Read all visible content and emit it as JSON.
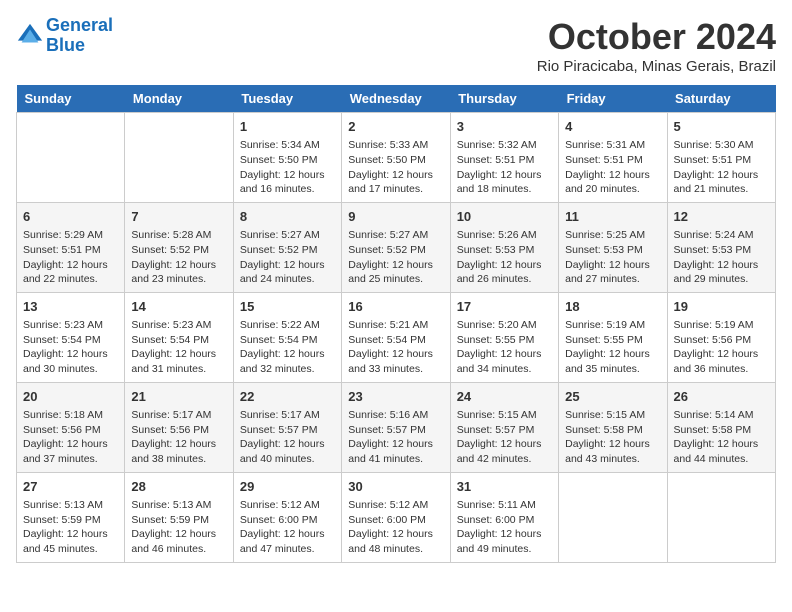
{
  "header": {
    "logo_line1": "General",
    "logo_line2": "Blue",
    "month": "October 2024",
    "location": "Rio Piracicaba, Minas Gerais, Brazil"
  },
  "days_of_week": [
    "Sunday",
    "Monday",
    "Tuesday",
    "Wednesday",
    "Thursday",
    "Friday",
    "Saturday"
  ],
  "weeks": [
    [
      {
        "num": "",
        "info": ""
      },
      {
        "num": "",
        "info": ""
      },
      {
        "num": "1",
        "info": "Sunrise: 5:34 AM\nSunset: 5:50 PM\nDaylight: 12 hours and 16 minutes."
      },
      {
        "num": "2",
        "info": "Sunrise: 5:33 AM\nSunset: 5:50 PM\nDaylight: 12 hours and 17 minutes."
      },
      {
        "num": "3",
        "info": "Sunrise: 5:32 AM\nSunset: 5:51 PM\nDaylight: 12 hours and 18 minutes."
      },
      {
        "num": "4",
        "info": "Sunrise: 5:31 AM\nSunset: 5:51 PM\nDaylight: 12 hours and 20 minutes."
      },
      {
        "num": "5",
        "info": "Sunrise: 5:30 AM\nSunset: 5:51 PM\nDaylight: 12 hours and 21 minutes."
      }
    ],
    [
      {
        "num": "6",
        "info": "Sunrise: 5:29 AM\nSunset: 5:51 PM\nDaylight: 12 hours and 22 minutes."
      },
      {
        "num": "7",
        "info": "Sunrise: 5:28 AM\nSunset: 5:52 PM\nDaylight: 12 hours and 23 minutes."
      },
      {
        "num": "8",
        "info": "Sunrise: 5:27 AM\nSunset: 5:52 PM\nDaylight: 12 hours and 24 minutes."
      },
      {
        "num": "9",
        "info": "Sunrise: 5:27 AM\nSunset: 5:52 PM\nDaylight: 12 hours and 25 minutes."
      },
      {
        "num": "10",
        "info": "Sunrise: 5:26 AM\nSunset: 5:53 PM\nDaylight: 12 hours and 26 minutes."
      },
      {
        "num": "11",
        "info": "Sunrise: 5:25 AM\nSunset: 5:53 PM\nDaylight: 12 hours and 27 minutes."
      },
      {
        "num": "12",
        "info": "Sunrise: 5:24 AM\nSunset: 5:53 PM\nDaylight: 12 hours and 29 minutes."
      }
    ],
    [
      {
        "num": "13",
        "info": "Sunrise: 5:23 AM\nSunset: 5:54 PM\nDaylight: 12 hours and 30 minutes."
      },
      {
        "num": "14",
        "info": "Sunrise: 5:23 AM\nSunset: 5:54 PM\nDaylight: 12 hours and 31 minutes."
      },
      {
        "num": "15",
        "info": "Sunrise: 5:22 AM\nSunset: 5:54 PM\nDaylight: 12 hours and 32 minutes."
      },
      {
        "num": "16",
        "info": "Sunrise: 5:21 AM\nSunset: 5:54 PM\nDaylight: 12 hours and 33 minutes."
      },
      {
        "num": "17",
        "info": "Sunrise: 5:20 AM\nSunset: 5:55 PM\nDaylight: 12 hours and 34 minutes."
      },
      {
        "num": "18",
        "info": "Sunrise: 5:19 AM\nSunset: 5:55 PM\nDaylight: 12 hours and 35 minutes."
      },
      {
        "num": "19",
        "info": "Sunrise: 5:19 AM\nSunset: 5:56 PM\nDaylight: 12 hours and 36 minutes."
      }
    ],
    [
      {
        "num": "20",
        "info": "Sunrise: 5:18 AM\nSunset: 5:56 PM\nDaylight: 12 hours and 37 minutes."
      },
      {
        "num": "21",
        "info": "Sunrise: 5:17 AM\nSunset: 5:56 PM\nDaylight: 12 hours and 38 minutes."
      },
      {
        "num": "22",
        "info": "Sunrise: 5:17 AM\nSunset: 5:57 PM\nDaylight: 12 hours and 40 minutes."
      },
      {
        "num": "23",
        "info": "Sunrise: 5:16 AM\nSunset: 5:57 PM\nDaylight: 12 hours and 41 minutes."
      },
      {
        "num": "24",
        "info": "Sunrise: 5:15 AM\nSunset: 5:57 PM\nDaylight: 12 hours and 42 minutes."
      },
      {
        "num": "25",
        "info": "Sunrise: 5:15 AM\nSunset: 5:58 PM\nDaylight: 12 hours and 43 minutes."
      },
      {
        "num": "26",
        "info": "Sunrise: 5:14 AM\nSunset: 5:58 PM\nDaylight: 12 hours and 44 minutes."
      }
    ],
    [
      {
        "num": "27",
        "info": "Sunrise: 5:13 AM\nSunset: 5:59 PM\nDaylight: 12 hours and 45 minutes."
      },
      {
        "num": "28",
        "info": "Sunrise: 5:13 AM\nSunset: 5:59 PM\nDaylight: 12 hours and 46 minutes."
      },
      {
        "num": "29",
        "info": "Sunrise: 5:12 AM\nSunset: 6:00 PM\nDaylight: 12 hours and 47 minutes."
      },
      {
        "num": "30",
        "info": "Sunrise: 5:12 AM\nSunset: 6:00 PM\nDaylight: 12 hours and 48 minutes."
      },
      {
        "num": "31",
        "info": "Sunrise: 5:11 AM\nSunset: 6:00 PM\nDaylight: 12 hours and 49 minutes."
      },
      {
        "num": "",
        "info": ""
      },
      {
        "num": "",
        "info": ""
      }
    ]
  ]
}
